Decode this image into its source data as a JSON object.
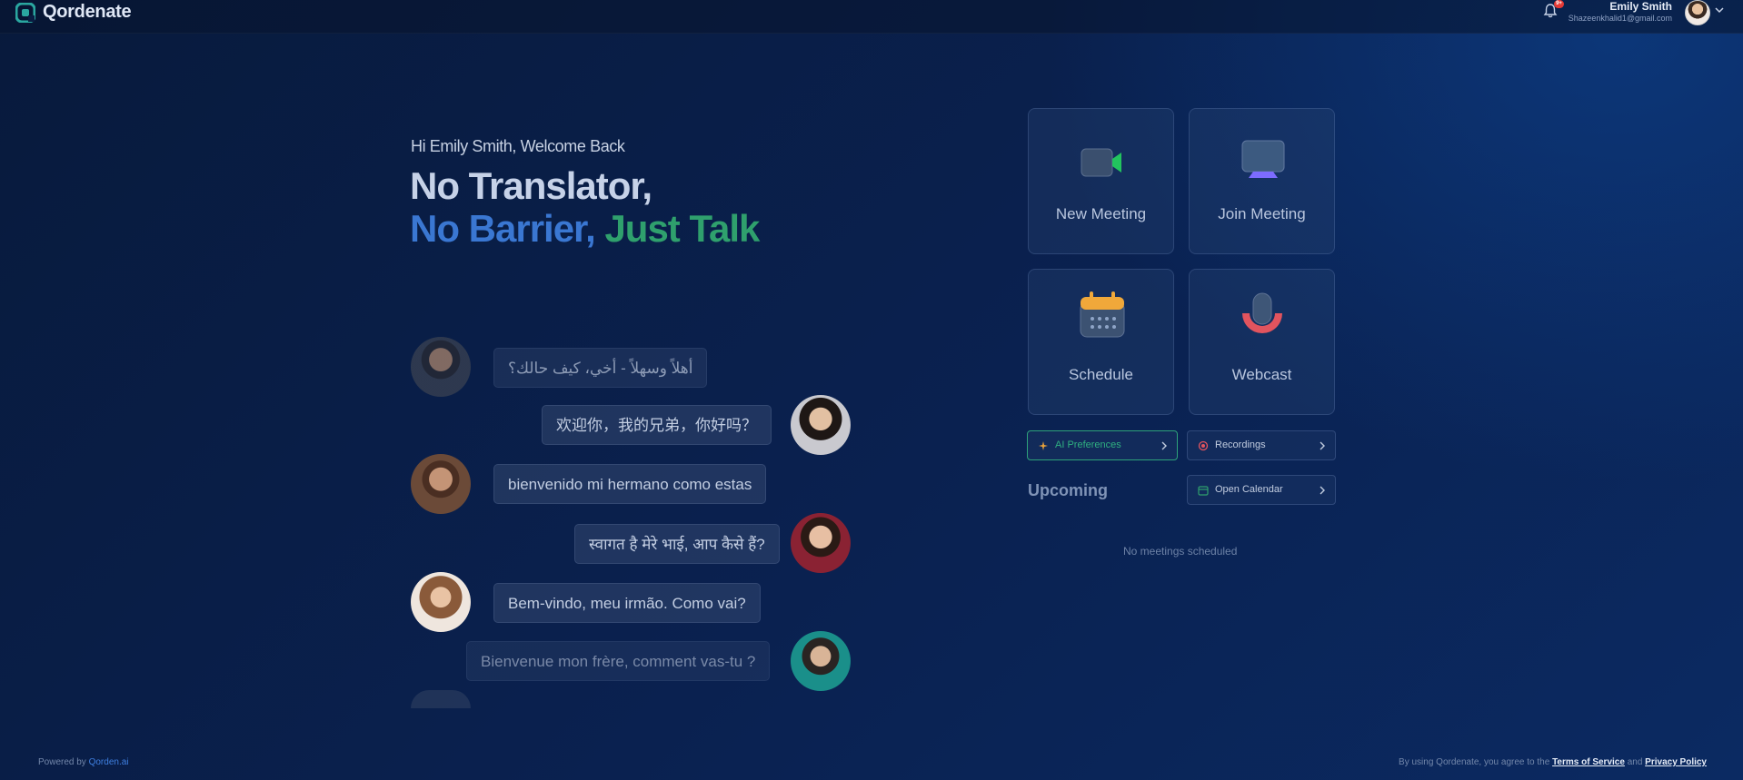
{
  "app": {
    "name": "Qordenate"
  },
  "header": {
    "notification_count": "9+",
    "user_name": "Emily Smith",
    "user_email": "Shazeenkhalid1@gmail.com"
  },
  "hero": {
    "greeting": "Hi Emily Smith, Welcome Back",
    "headline_line1": "No Translator,",
    "headline_blue": "No Barrier,",
    "headline_green": "Just Talk"
  },
  "chat": [
    {
      "text": "أهلاً وسهلاً - أخي، كيف حالك؟",
      "side": "left"
    },
    {
      "text": "欢迎你，我的兄弟，你好吗？",
      "side": "right"
    },
    {
      "text": "bienvenido mi hermano como estas",
      "side": "left"
    },
    {
      "text": "स्वागत है मेरे भाई, आप कैसे हैं?",
      "side": "right"
    },
    {
      "text": "Bem-vindo, meu irmão. Como vai?",
      "side": "left"
    },
    {
      "text": "Bienvenue mon frère, comment vas-tu ?",
      "side": "right"
    }
  ],
  "actions": {
    "new_meeting": "New Meeting",
    "join_meeting": "Join Meeting",
    "schedule": "Schedule",
    "webcast": "Webcast"
  },
  "pills": {
    "ai_preferences": "AI Preferences",
    "recordings": "Recordings",
    "open_calendar": "Open Calendar"
  },
  "upcoming": {
    "title": "Upcoming",
    "empty": "No meetings scheduled"
  },
  "footer": {
    "powered_prefix": "Powered by",
    "powered_brand": "Qorden.ai",
    "agree_prefix": "By using Qordenate, you agree to the",
    "terms": "Terms of Service",
    "and": "and",
    "privacy": "Privacy Policy"
  },
  "colors": {
    "accent_blue": "#3a77d2",
    "accent_green": "#2fa06d",
    "badge_red": "#e53935"
  }
}
